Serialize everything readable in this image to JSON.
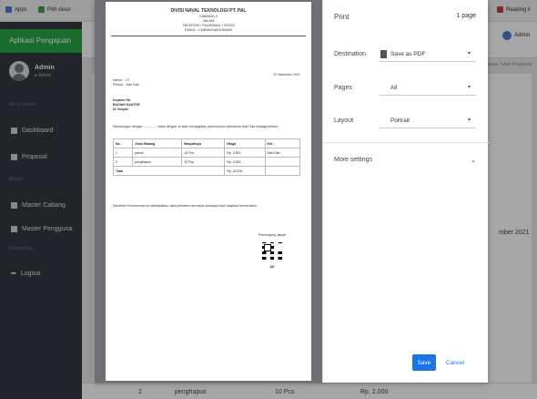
{
  "bookmarks": {
    "apps": "Apps",
    "item2": "Pdh Akun",
    "item3": "Reading li"
  },
  "sidebar": {
    "brand": "Aplikasi Pengajuan",
    "user_name": "Admin",
    "user_role": "● Admin",
    "section_menu": "Menu Utama",
    "items": [
      {
        "label": "Dashboard"
      },
      {
        "label": "Proposal"
      }
    ],
    "section_master": "Master",
    "master_items": [
      {
        "label": "Master Cabang"
      },
      {
        "label": "Master Pengguna"
      }
    ],
    "section_other": "Pengaturan",
    "logout": "Logout"
  },
  "topbar": {
    "admin": "Admin",
    "breadcrumb": "Menu Utama  /  Unit Proposal",
    "date_fragment": "mber 2021"
  },
  "bg_table": {
    "no": "2",
    "item": "penghapus",
    "qty": "10 Pcs",
    "price": "Rp. 2.000"
  },
  "document": {
    "org": "DIVISI NAVAL TEKNOLOGI PT. PAL",
    "header_lines": [
      "CABANG 1",
      "JALAN",
      "TELEPON / FAX/EMAIL / SITUS",
      "EMAIL : CABANG@DOMAIN"
    ],
    "date": "22 November 2021",
    "nomor_label": "Nomor",
    "nomor_value": ": 27",
    "perihal_label": "Perihal",
    "perihal_value": ": Alat Tulis",
    "to_lines": [
      "Kepada Yth.",
      "BAGIAN KANTOR",
      "Di Tempat"
    ],
    "body": "Sehubungan dengan ............... maka dengan ini kami mengajukan permohonan kebutuhan Alat Tulis sebagai berikut :",
    "table_headers": [
      "No.",
      "Jenis Barang",
      "Banyaknya",
      "Harga",
      "Ket."
    ],
    "rows": [
      [
        "1",
        "pensil",
        "10 Pcs",
        "Rp. 2.000",
        "Alat Tulis"
      ],
      [
        "2",
        "penghapus",
        "10 Pcs",
        "Rp. 2.000",
        ""
      ]
    ],
    "total_label": "Total",
    "total_value": "Rp. 40.000",
    "closing": "Demikian Permohonan ini disampaikan, atas perhatian dan kerja samanya kami ucapkan terima kasih.",
    "sign_title": "Pemengang Jawab",
    "sign_name": "AD"
  },
  "print": {
    "title": "Print",
    "pages_count": "1 page",
    "destination_label": "Destination",
    "destination_value": "Save as PDF",
    "pages_label": "Pages",
    "pages_value": "All",
    "layout_label": "Layout",
    "layout_value": "Portrait",
    "more_settings": "More settings",
    "save": "Save",
    "cancel": "Cancel"
  }
}
